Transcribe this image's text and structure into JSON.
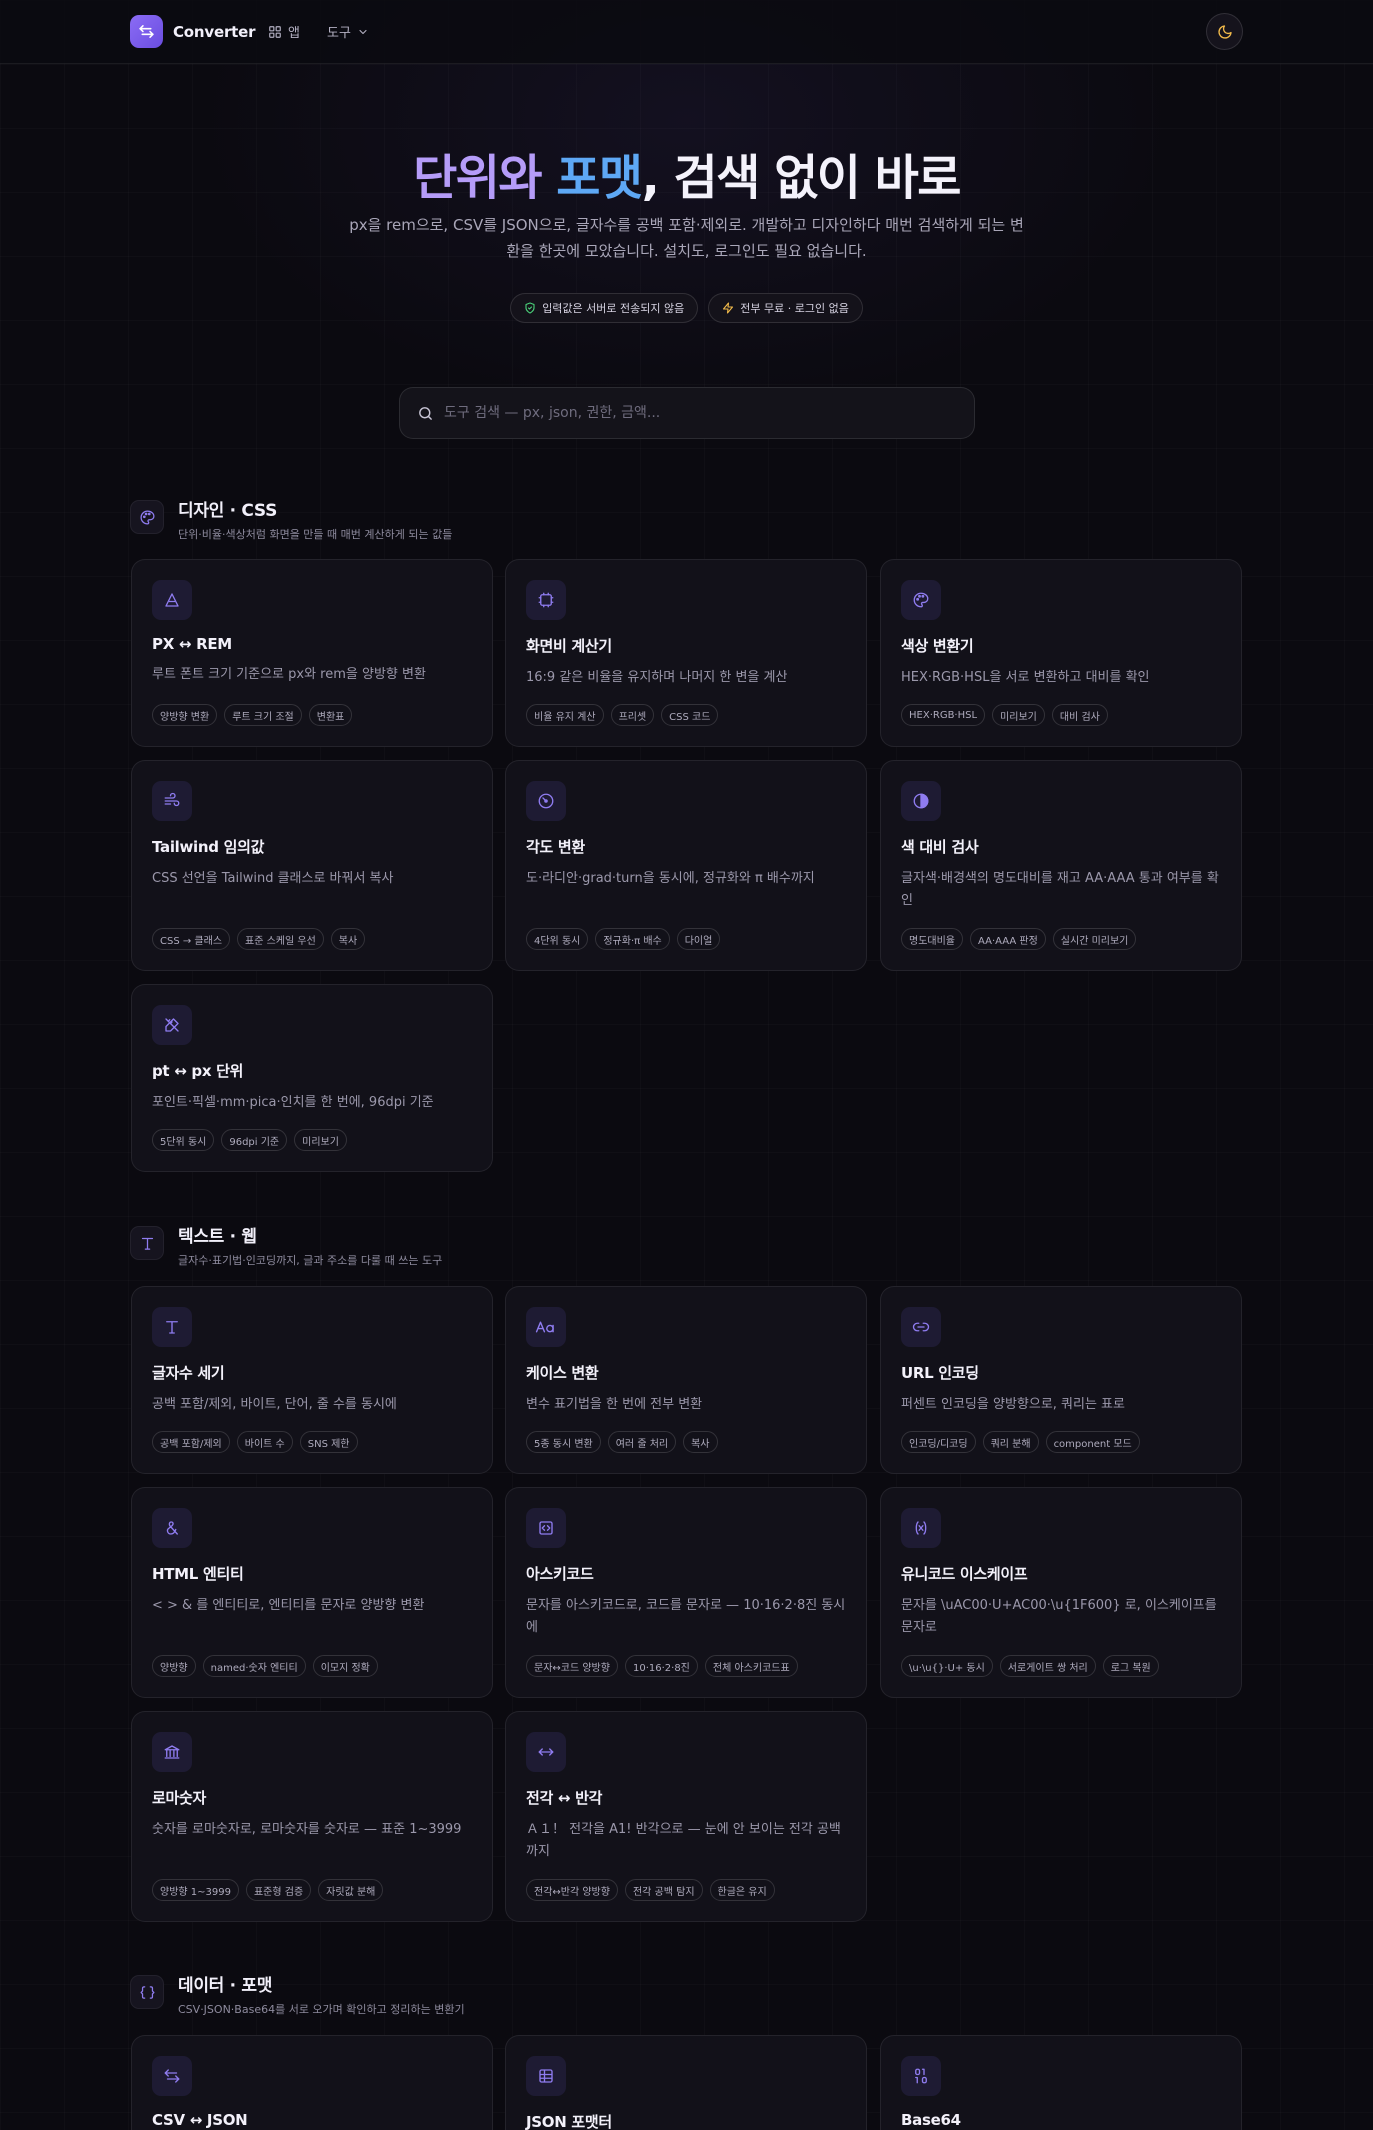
{
  "header": {
    "brand": "Converter",
    "apps_label": "앱",
    "tools_label": "도구"
  },
  "hero": {
    "title_part1": "단위와",
    "title_part2": "포맷",
    "title_part3": ", 검색 없이 바로",
    "subtitle": "px을 rem으로, CSV를 JSON으로, 글자수를 공백 포함·제외로. 개발하고 디자인하다 매번 검색하게 되는 변환을 한곳에 모았습니다. 설치도, 로그인도 필요 없습니다.",
    "badge_privacy": "입력값은 서버로 전송되지 않음",
    "badge_free": "전부 무료 · 로그인 없음"
  },
  "search": {
    "placeholder": "도구 검색 — px, json, 권한, 금액..."
  },
  "sections": [
    {
      "title": "디자인 · CSS",
      "desc": "단위·비율·색상처럼 화면을 만들 때 매번 계산하게 되는 값들",
      "cards": [
        {
          "title": "PX ↔ REM",
          "desc": "루트 폰트 크기 기준으로 px와 rem을 양방향 변환",
          "tags": [
            "양방향 변환",
            "루트 크기 조절",
            "변환표"
          ]
        },
        {
          "title": "화면비 계산기",
          "desc": "16:9 같은 비율을 유지하며 나머지 한 변을 계산",
          "tags": [
            "비율 유지 계산",
            "프리셋",
            "CSS 코드"
          ]
        },
        {
          "title": "색상 변환기",
          "desc": "HEX·RGB·HSL을 서로 변환하고 대비를 확인",
          "tags": [
            "HEX·RGB·HSL",
            "미리보기",
            "대비 검사"
          ]
        },
        {
          "title": "Tailwind 임의값",
          "desc": "CSS 선언을 Tailwind 클래스로 바꿔서 복사",
          "tags": [
            "CSS → 클래스",
            "표준 스케일 우선",
            "복사"
          ]
        },
        {
          "title": "각도 변환",
          "desc": "도·라디안·grad·turn을 동시에, 정규화와 π 배수까지",
          "tags": [
            "4단위 동시",
            "정규화·π 배수",
            "다이얼"
          ]
        },
        {
          "title": "색 대비 검사",
          "desc": "글자색·배경색의 명도대비를 재고 AA·AAA 통과 여부를 확인",
          "tags": [
            "명도대비율",
            "AA·AAA 판정",
            "실시간 미리보기"
          ]
        },
        {
          "title": "pt ↔ px 단위",
          "desc": "포인트·픽셀·mm·pica·인치를 한 번에, 96dpi 기준",
          "tags": [
            "5단위 동시",
            "96dpi 기준",
            "미리보기"
          ]
        }
      ]
    },
    {
      "title": "텍스트 · 웹",
      "desc": "글자수·표기법·인코딩까지, 글과 주소를 다룰 때 쓰는 도구",
      "cards": [
        {
          "title": "글자수 세기",
          "desc": "공백 포함/제외, 바이트, 단어, 줄 수를 동시에",
          "tags": [
            "공백 포함/제외",
            "바이트 수",
            "SNS 제한"
          ]
        },
        {
          "title": "케이스 변환",
          "desc": "변수 표기법을 한 번에 전부 변환",
          "tags": [
            "5종 동시 변환",
            "여러 줄 처리",
            "복사"
          ]
        },
        {
          "title": "URL 인코딩",
          "desc": "퍼센트 인코딩을 양방향으로, 쿼리는 표로",
          "tags": [
            "인코딩/디코딩",
            "쿼리 분해",
            "component 모드"
          ]
        },
        {
          "title": "HTML 엔티티",
          "desc": "< > & 를 엔티티로, 엔티티를 문자로 양방향 변환",
          "tags": [
            "양방향",
            "named·숫자 엔티티",
            "이모지 정확"
          ]
        },
        {
          "title": "아스키코드",
          "desc": "문자를 아스키코드로, 코드를 문자로 — 10·16·2·8진 동시에",
          "tags": [
            "문자↔코드 양방향",
            "10·16·2·8진",
            "전체 아스키코드표"
          ]
        },
        {
          "title": "유니코드 이스케이프",
          "desc": "문자를 \\uAC00·U+AC00·\\u{1F600} 로, 이스케이프를 문자로",
          "tags": [
            "\\u·\\u{}·U+ 동시",
            "서로게이트 쌍 처리",
            "로그 복원"
          ]
        },
        {
          "title": "로마숫자",
          "desc": "숫자를 로마숫자로, 로마숫자를 숫자로 — 표준 1~3999",
          "tags": [
            "양방향 1~3999",
            "표준형 검증",
            "자릿값 분해"
          ]
        },
        {
          "title": "전각 ↔ 반각",
          "desc": "Ａ１！ 전각을 A1! 반각으로 — 눈에 안 보이는 전각 공백까지",
          "tags": [
            "전각↔반각 양방향",
            "전각 공백 탐지",
            "한글은 유지"
          ]
        }
      ]
    },
    {
      "title": "데이터 · 포맷",
      "desc": "CSV·JSON·Base64를 서로 오가며 확인하고 정리하는 변환기",
      "cards": [
        {
          "title": "CSV ↔ JSON"
        },
        {
          "title": "JSON 포맷터"
        },
        {
          "title": "Base64"
        }
      ]
    }
  ]
}
